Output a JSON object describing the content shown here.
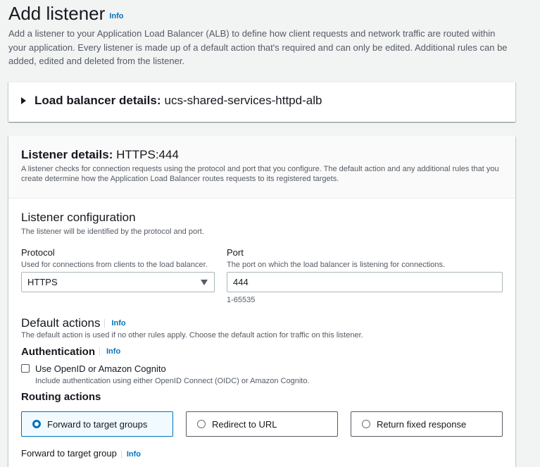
{
  "page": {
    "title": "Add listener",
    "info": "Info",
    "intro": "Add a listener to your Application Load Balancer (ALB) to define how client requests and network traffic are routed within your application. Every listener is made up of a default action that's required and can only be edited. Additional rules can be added, edited and deleted from the listener."
  },
  "lb_details": {
    "label": "Load balancer details:",
    "value": "ucs-shared-services-httpd-alb"
  },
  "listener_details": {
    "label": "Listener details:",
    "value": "HTTPS:444",
    "description": "A listener checks for connection requests using the protocol and port that you configure. The default action and any additional rules that you create determine how the Application Load Balancer routes requests to its registered targets."
  },
  "config": {
    "title": "Listener configuration",
    "description": "The listener will be identified by the protocol and port.",
    "protocol_label": "Protocol",
    "protocol_desc": "Used for connections from clients to the load balancer.",
    "protocol_value": "HTTPS",
    "port_label": "Port",
    "port_desc": "The port on which the load balancer is listening for connections.",
    "port_value": "444",
    "port_hint": "1-65535"
  },
  "default_actions": {
    "title": "Default actions",
    "info": "Info",
    "description": "The default action is used if no other rules apply. Choose the default action for traffic on this listener."
  },
  "authentication": {
    "title": "Authentication",
    "info": "Info",
    "checkbox_label": "Use OpenID or Amazon Cognito",
    "checkbox_checked": false,
    "checkbox_desc": "Include authentication using either OpenID Connect (OIDC) or Amazon Cognito."
  },
  "routing": {
    "title": "Routing actions",
    "options": [
      {
        "label": "Forward to target groups",
        "selected": true
      },
      {
        "label": "Redirect to URL",
        "selected": false
      },
      {
        "label": "Return fixed response",
        "selected": false
      }
    ]
  },
  "forward": {
    "title": "Forward to target group",
    "info": "Info"
  },
  "colors": {
    "link": "#0073bb",
    "selected_border": "#0073bb",
    "selected_bg": "#f1faff"
  }
}
